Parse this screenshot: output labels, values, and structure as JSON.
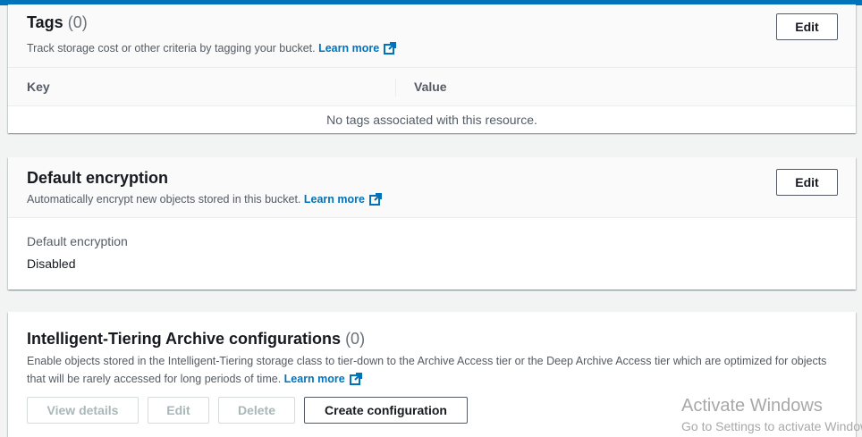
{
  "tags": {
    "title": "Tags",
    "count": "(0)",
    "description": "Track storage cost or other criteria by tagging your bucket.",
    "learn_more": "Learn more",
    "edit_label": "Edit",
    "columns": [
      "Key",
      "Value"
    ],
    "empty_message": "No tags associated with this resource."
  },
  "encryption": {
    "title": "Default encryption",
    "description": "Automatically encrypt new objects stored in this bucket.",
    "learn_more": "Learn more",
    "edit_label": "Edit",
    "field_label": "Default encryption",
    "field_value": "Disabled"
  },
  "tiering": {
    "title": "Intelligent-Tiering Archive configurations",
    "count": "(0)",
    "description": "Enable objects stored in the Intelligent-Tiering storage class to tier-down to the Archive Access tier or the Deep Archive Access tier which are optimized for objects that will be rarely accessed for long periods of time.",
    "learn_more": "Learn more",
    "buttons": {
      "view_details": "View details",
      "edit": "Edit",
      "delete": "Delete",
      "create": "Create configuration"
    }
  },
  "watermark": {
    "line1": "Activate Windows",
    "line2": "Go to Settings to activate Windows."
  },
  "colors": {
    "accent": "#0073bb",
    "link": "#0073bb",
    "page_background": "#f2f3f3"
  },
  "icons": {
    "external_link": "external-link-icon"
  }
}
